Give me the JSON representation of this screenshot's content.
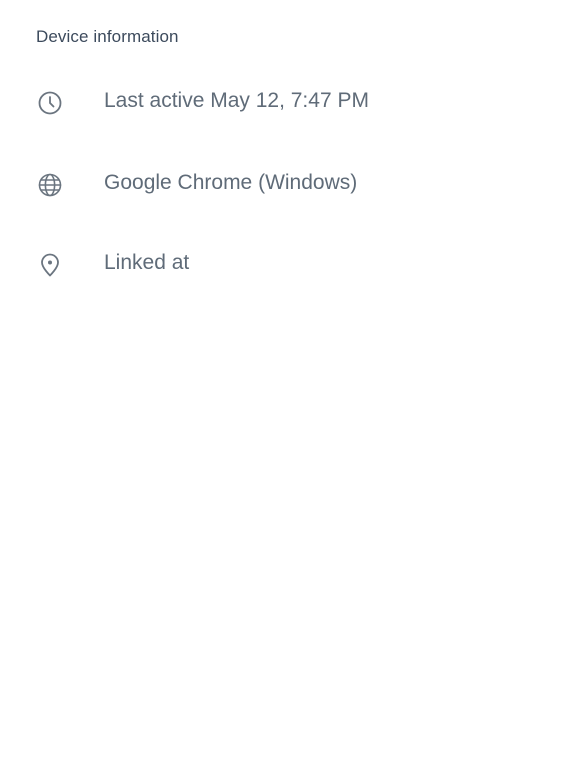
{
  "section": {
    "title": "Device information"
  },
  "rows": [
    {
      "icon": "clock-icon",
      "text": "Last active May 12, 7:47 PM"
    },
    {
      "icon": "globe-icon",
      "text": "Google Chrome (Windows)"
    },
    {
      "icon": "location-pin-icon",
      "text": "Linked at"
    }
  ],
  "colors": {
    "title": "#3c4a5c",
    "text": "#5f6b78",
    "icon": "#6b7580",
    "background": "#ffffff"
  }
}
